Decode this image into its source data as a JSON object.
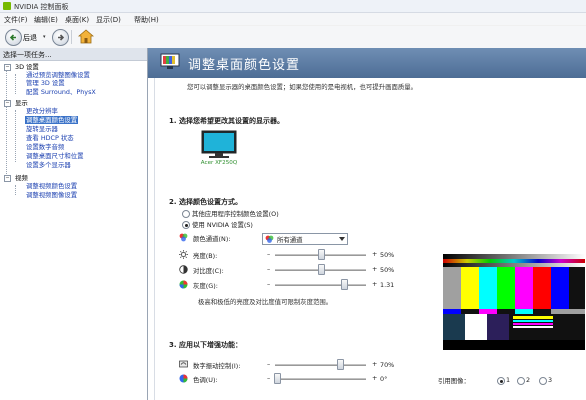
{
  "window": {
    "title": "NVIDIA 控制面板"
  },
  "menu": [
    "文件(F)",
    "编辑(E)",
    "桌面(K)",
    "显示(D)",
    "帮助(H)"
  ],
  "toolbar": {
    "back_label": "后退"
  },
  "left": {
    "header": "选择一项任务...",
    "tree": [
      {
        "type": "cat",
        "label": "3D 设置"
      },
      {
        "type": "link",
        "label": "通过预览调整图像设置"
      },
      {
        "type": "link",
        "label": "管理 3D 设置"
      },
      {
        "type": "link",
        "label": "配置 Surround、PhysX"
      },
      {
        "type": "cat",
        "label": "显示"
      },
      {
        "type": "link",
        "label": "更改分辨率"
      },
      {
        "type": "selected",
        "label": "调整桌面颜色设置"
      },
      {
        "type": "link",
        "label": "旋转显示器"
      },
      {
        "type": "link",
        "label": "查看 HDCP 状态"
      },
      {
        "type": "link",
        "label": "设置数字音频"
      },
      {
        "type": "link",
        "label": "调整桌面尺寸和位置"
      },
      {
        "type": "link",
        "label": "设置多个显示器"
      },
      {
        "type": "cat",
        "label": "视频"
      },
      {
        "type": "link",
        "label": "调整视频颜色设置"
      },
      {
        "type": "link",
        "label": "调整视频图像设置"
      }
    ]
  },
  "main": {
    "title": "调整桌面颜色设置",
    "description": "您可以调整显示器的桌面颜色设置；如果您使用的是电视机，也可提升画面质量。",
    "section1": "1.  选择您希望更改其设置的显示器。",
    "monitor_name": "Acer XF250Q",
    "section2": "2.  选择颜色设置方式。",
    "radio_other": "其他应用程序控制颜色设置(O)",
    "radio_nvidia": "使用 NVIDIA 设置(S)",
    "channel_label": "颜色通道(N):",
    "channel_value": "所有通道",
    "brightness": {
      "label": "亮度(B):",
      "value": "50%"
    },
    "contrast": {
      "label": "对比度(C):",
      "value": "50%"
    },
    "gamma": {
      "label": "灰度(G):",
      "value": "1.31"
    },
    "note": "极高和极低的亮度及对比度值可限制灰度范围。",
    "section3": "3.  应用以下增强功能：",
    "vibrance": {
      "label": "数字振动控制(I):",
      "value": "70%"
    },
    "hue": {
      "label": "色调(U):",
      "value": "0°"
    },
    "reference_label": "引用图像：",
    "ref_options": [
      "1",
      "2",
      "3"
    ]
  }
}
